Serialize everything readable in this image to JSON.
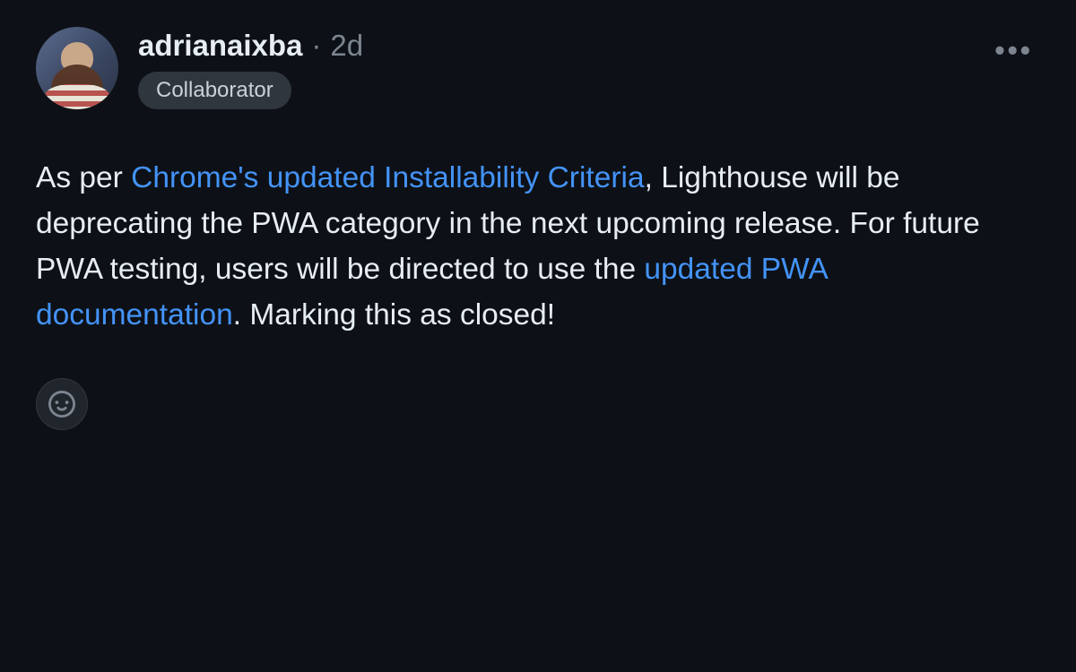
{
  "comment": {
    "author": {
      "username": "adrianaixba",
      "badge_label": "Collaborator"
    },
    "timestamp": "2d",
    "separator": "·",
    "body": {
      "part1": "As per ",
      "link1": "Chrome's updated Installability Criteria",
      "part2": ", Lighthouse will be deprecating the PWA category in the next upcoming release. For future PWA testing, users will be directed to use the ",
      "link2": "updated PWA documentation",
      "part3": ". Marking this as closed!"
    }
  },
  "icons": {
    "more": "•••",
    "reaction_smiley": "smiley-icon"
  }
}
